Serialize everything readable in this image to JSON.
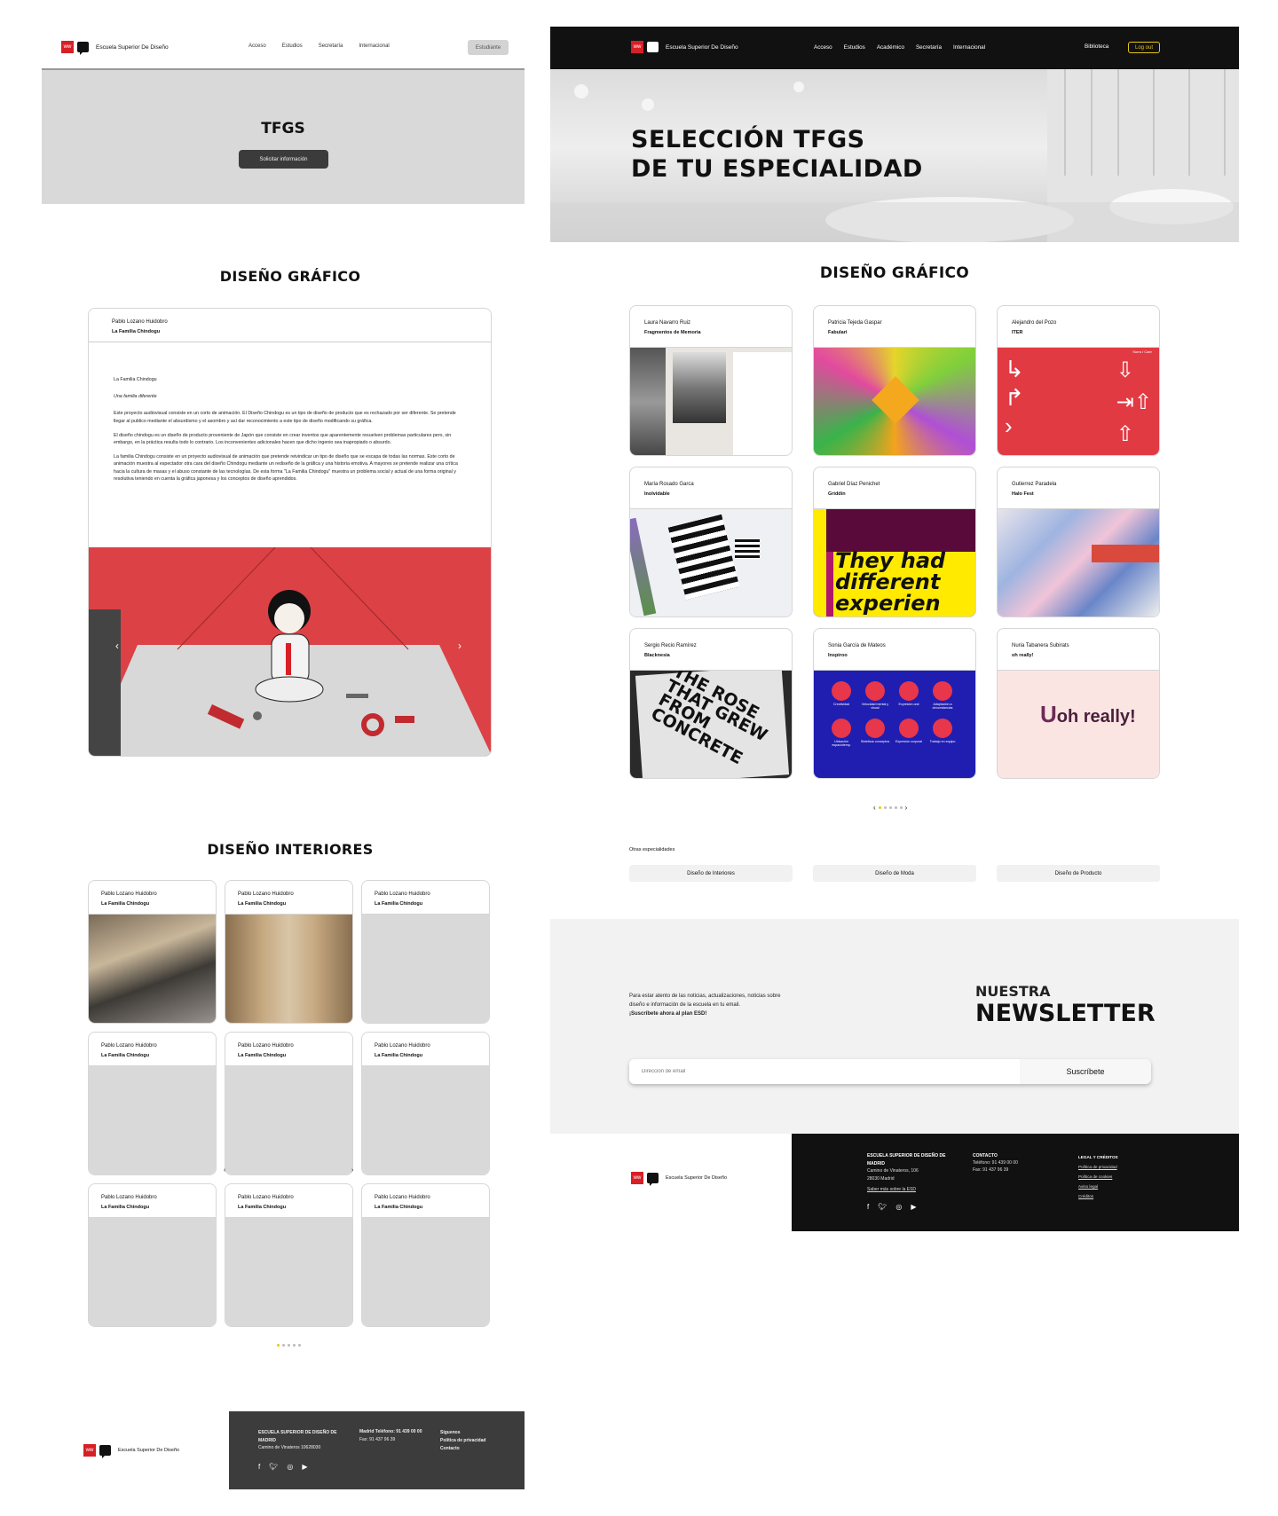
{
  "left": {
    "brand": "Escuela Superior De Diseño",
    "nav": [
      "Acceso",
      "Estudios",
      "Secretaría",
      "Internacional"
    ],
    "student_button": "Estudiante",
    "hero_title": "TFGS",
    "hero_button": "Solicitar información",
    "grafico": {
      "title": "DISEÑO GRÁFICO",
      "author": "Pablo Lozano Huidobro",
      "project": "La Familia Chindogu",
      "body_title": "La Familia Chindogu",
      "body_subtitle": "Una familia diferente",
      "paragraphs": [
        "Este proyecto audiovisual consiste en un corto de animación. El Diseño Chindogu es un tipo de diseño de producto que es rechazado por ser diferente. Se pretende llegar al publico mediante el absurdismo y el asombro y así dar reconocimiento a este tipo de diseño modificando su gráfica.",
        "El diseño chindogu es un diseño de producto proveniente de Japón que consiste en crear inventos que aparentemente resuelven problemas particulares pero, sin embargo, en la práctica resulta todo lo contrario. Los inconvenientes adicionales hacen que dicho ingenio sea inapropiado o absurdo.",
        "La familia Chindogu consiste en un proyecto audiovisual de animación que pretende reivindicar un tipo de diseño que se escapa de todas las normas. Este corto de animación muestra al espectador otra cara del diseño Chindogu mediante un rediseño de la gráfica y una historia emotiva. A mayores se pretende realizar una crítica hacia la cultura de masas y el abuso constante de las tecnologías. De esta forma \"La Familia Chindogu\" muestra un problema social y actual de una forma original y resolutiva teniendo en cuenta la gráfica japonesa y los conceptos de diseño aprendidos."
      ]
    },
    "interiores": {
      "title": "DISEÑO INTERIORES",
      "cards": [
        {
          "author": "Pablo Lozano Huidobro",
          "project": "La Familia Chindogu"
        },
        {
          "author": "Pablo Lozano Huidobro",
          "project": "La Familia Chindogu"
        },
        {
          "author": "Pablo Lozano Huidobro",
          "project": "La Familia Chindogu"
        },
        {
          "author": "Pablo Lozano Huidobro",
          "project": "La Familia Chindogu"
        },
        {
          "author": "Pablo Lozano Huidobro",
          "project": "La Familia Chindogu"
        },
        {
          "author": "Pablo Lozano Huidobro",
          "project": "La Familia Chindogu"
        },
        {
          "author": "Pablo Lozano Huidobro",
          "project": "La Familia Chindogu"
        },
        {
          "author": "Pablo Lozano Huidobro",
          "project": "La Familia Chindogu"
        },
        {
          "author": "Pablo Lozano Huidobro",
          "project": "La Familia Chindogu"
        }
      ]
    },
    "footer": {
      "school": "ESCUELA SUPERIOR DE DISEÑO DE MADRID",
      "address": "Camino de Vinateros 10628030",
      "phone": "Madrid Teléfono: 91 439 00 00",
      "fax": "Fax: 91 437 96 39",
      "links": [
        "Síguenos",
        "Política de privacidad",
        "Contacto"
      ]
    }
  },
  "right": {
    "brand": "Escuela Superior De Diseño",
    "nav": [
      "Acceso",
      "Estudios",
      "Académico",
      "Secretaría",
      "Internacional"
    ],
    "library": "Biblioteca",
    "logout": "Log out",
    "hero_line1": "SELECCIÓN TFGS",
    "hero_line2": "DE TU ESPECIALIDAD",
    "section_title": "DISEÑO GRÁFICO",
    "cards": [
      {
        "author": "Laura Navarro Ruiz",
        "project": "Fragmentos de Memoria"
      },
      {
        "author": "Patricia Tejeda Gaspar",
        "project": "Fabulari"
      },
      {
        "author": "Alejandro del Pozo",
        "project": "ITER"
      },
      {
        "author": "María Rosado Garca",
        "project": "Inolvidable"
      },
      {
        "author": "Gabriel Díaz Penichet",
        "project": "Griddin"
      },
      {
        "author": "Gutierrez Paradela",
        "project": "Halo Fest"
      },
      {
        "author": "Sergio Recio Ramírez",
        "project": "Blacknesia"
      },
      {
        "author": "Sonia García de Mateos",
        "project": "Inspiroo"
      },
      {
        "author": "Nuria Tabanera Subirats",
        "project": "oh really!"
      }
    ],
    "poster_text": [
      "They had",
      "different",
      "experien"
    ],
    "shirt_text": "THE ROSE THAT GREW FROM CONCRETE",
    "inspiroo_labels": [
      "Creatividad",
      "Velocidad mental y visual",
      "Expresión oral",
      "Adaptación a circunstancias",
      "Ubicación espaciotemp.",
      "Sintetizar conceptos",
      "Expresión corporal",
      "Trabajo en equipo"
    ],
    "ohreally": "oh really!",
    "ohreally_small": "U",
    "iter_mini": "Sorra / Caer",
    "other_label": "Otras especialidades",
    "other": [
      "Diseño de Interiores",
      "Diseño de Moda",
      "Diseño de Producto"
    ],
    "newsletter": {
      "text": "Para estar atento de las noticias, actualizaciones, noticias sobre diseño e información de la escuela en tu email.",
      "cta": "¡Suscríbete ahora al plan ESD!",
      "title_small": "NUESTRA",
      "title_big": "NEWSLETTER",
      "placeholder": "Dirección de email",
      "button": "Suscríbete"
    },
    "footer": {
      "school": "ESCUELA SUPERIOR DE DISEÑO DE MADRID",
      "address1": "Camino de Vinateros, 106",
      "address2": "28030 Madrid",
      "more": "Saber más sobre la ESD",
      "contact_title": "CONTACTO",
      "phone": "Teléfono: 91 439 00 00",
      "fax": "Fax: 91 437 96 39",
      "legal_title": "LEGAL Y CRÉDITOS",
      "legal_links": [
        "Política de privacidad",
        "Política de cookies",
        "Aviso legal",
        "Créditos"
      ]
    }
  },
  "colors": {
    "accent": "#d71f26",
    "dark": "#1a1a1a",
    "yellow": "#e6c619",
    "panel": "#d9d9d9"
  }
}
